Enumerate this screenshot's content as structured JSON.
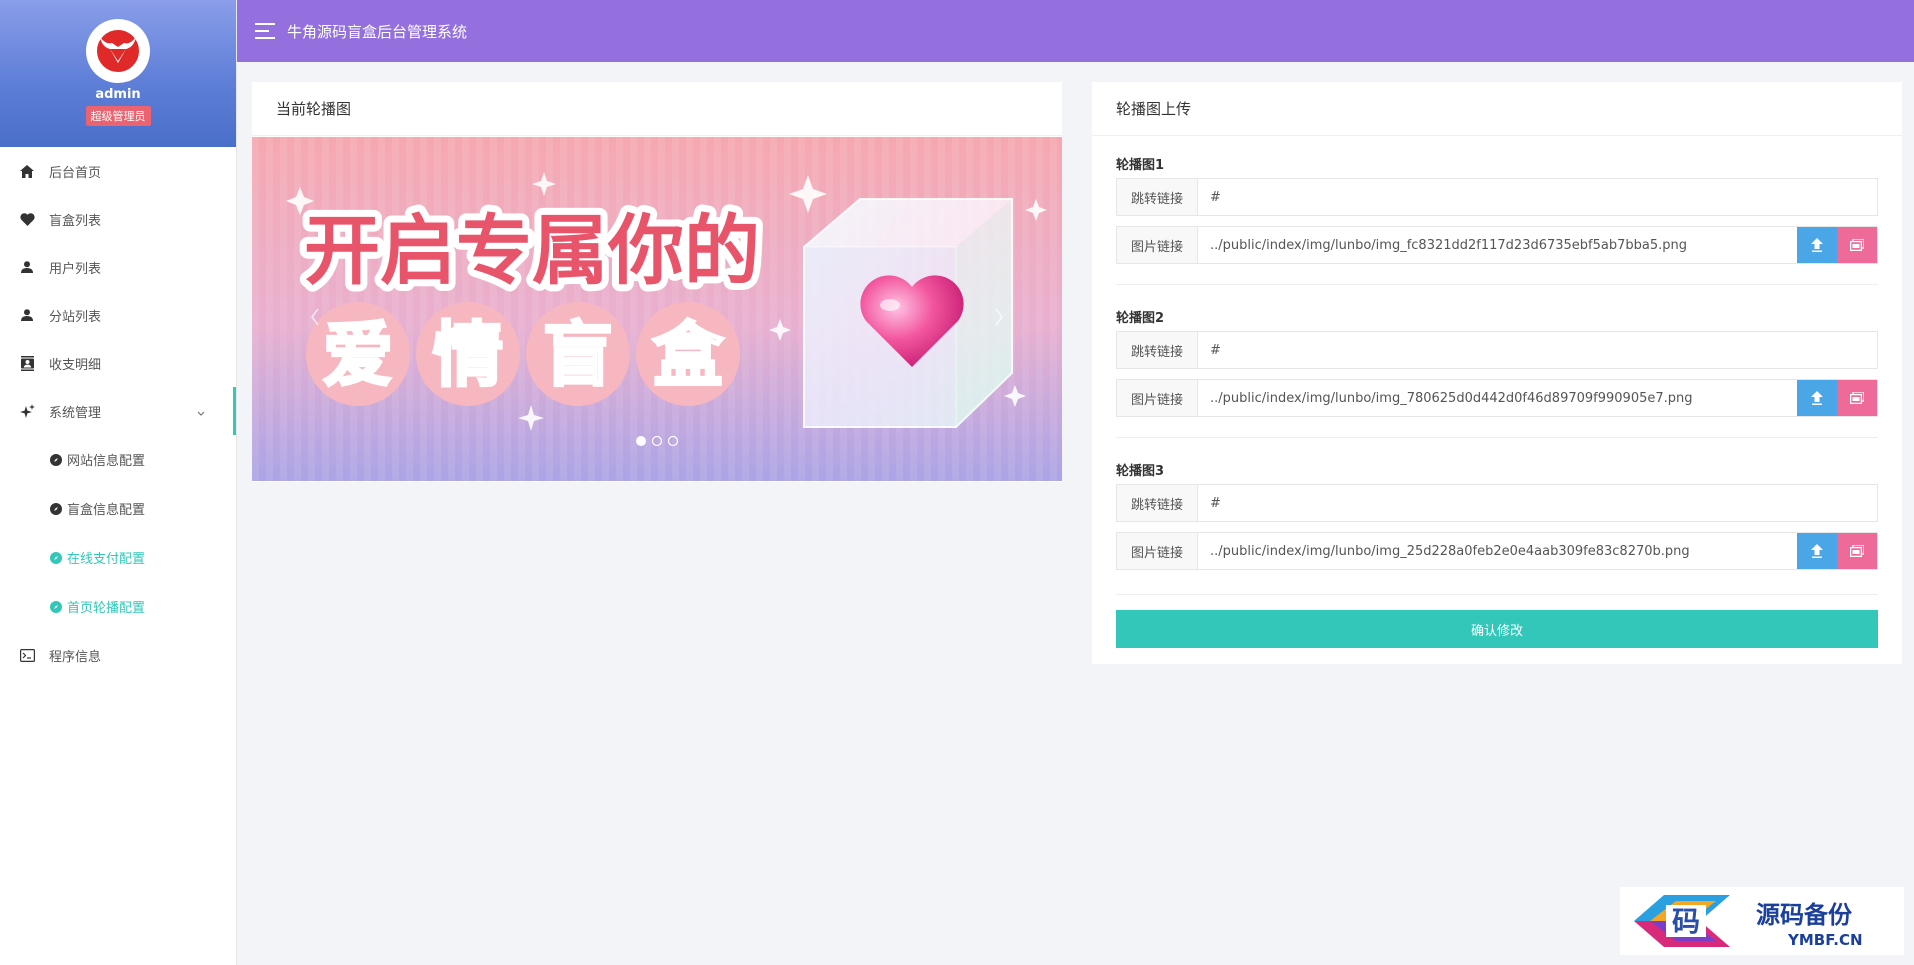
{
  "app": {
    "title": "牛角源码盲盒后台管理系统"
  },
  "profile": {
    "name": "admin",
    "role": "超级管理员"
  },
  "nav": {
    "items": [
      {
        "label": "后台首页",
        "icon": "home-icon"
      },
      {
        "label": "盲盒列表",
        "icon": "heart-icon"
      },
      {
        "label": "用户列表",
        "icon": "user-icon"
      },
      {
        "label": "分站列表",
        "icon": "user-icon"
      },
      {
        "label": "收支明细",
        "icon": "contacts-icon"
      },
      {
        "label": "系统管理",
        "icon": "sparkle-icon"
      }
    ],
    "sub_items": [
      {
        "label": "网站信息配置"
      },
      {
        "label": "盲盒信息配置"
      },
      {
        "label": "在线支付配置"
      },
      {
        "label": "首页轮播配置"
      }
    ],
    "program_info": "程序信息"
  },
  "preview": {
    "title": "当前轮播图",
    "banner_line1": "开启专属你的",
    "banner_line2": [
      "爱",
      "情",
      "盲",
      "盒"
    ]
  },
  "upload": {
    "title": "轮播图上传",
    "link_label": "跳转链接",
    "image_label": "图片链接",
    "groups": [
      {
        "label": "轮播图1",
        "link": "#",
        "image": "../public/index/img/lunbo/img_fc8321dd2f117d23d6735ebf5ab7bba5.png"
      },
      {
        "label": "轮播图2",
        "link": "#",
        "image": "../public/index/img/lunbo/img_780625d0d442d0f46d89709f990905e7.png"
      },
      {
        "label": "轮播图3",
        "link": "#",
        "image": "../public/index/img/lunbo/img_25d228a0feb2e0e4aab309fe83c8270b.png"
      }
    ],
    "confirm": "确认修改"
  },
  "watermark": {
    "glyph": "码",
    "text": "源码备份",
    "domain": "YMBF.CN"
  },
  "colors": {
    "topbar": "#9370de",
    "accent": "#32c7b8",
    "upload_btn": "#4ba6e8",
    "pick_btn": "#ee6a98",
    "badge": "#e96470"
  }
}
